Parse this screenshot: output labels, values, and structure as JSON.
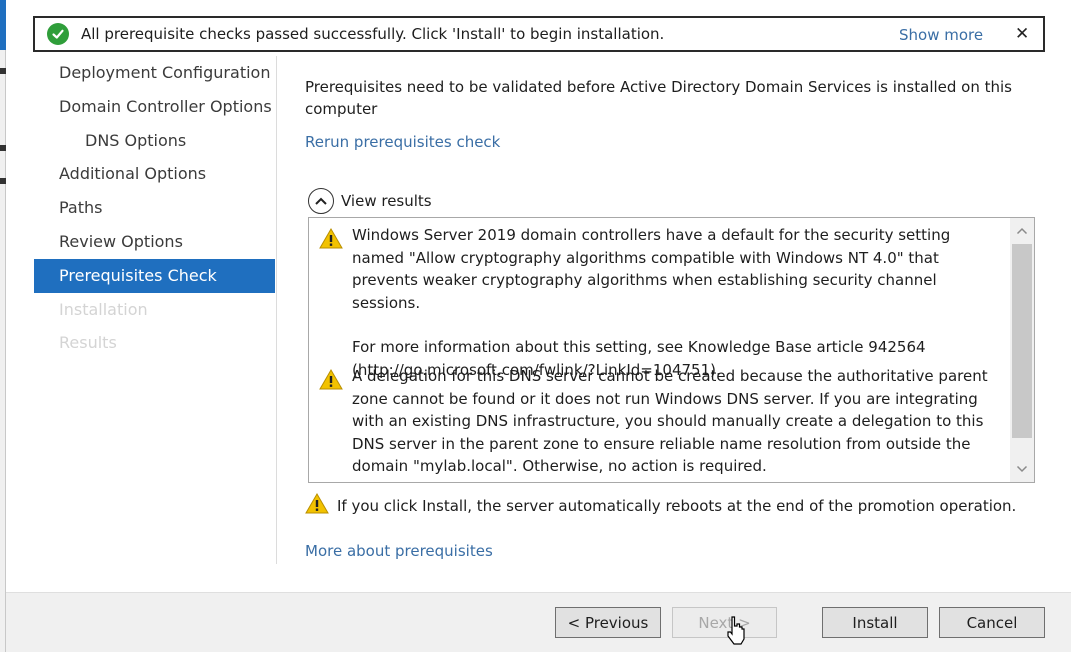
{
  "notification": {
    "message": "All prerequisite checks passed successfully.  Click 'Install' to begin installation.",
    "show_more_label": "Show more",
    "close_label": "✕",
    "status_color": "#2f9e3a"
  },
  "nav": {
    "items": [
      {
        "label": "Deployment Configuration",
        "state": "normal"
      },
      {
        "label": "Domain Controller Options",
        "state": "normal"
      },
      {
        "label": "DNS Options",
        "state": "sub"
      },
      {
        "label": "Additional Options",
        "state": "normal"
      },
      {
        "label": "Paths",
        "state": "normal"
      },
      {
        "label": "Review Options",
        "state": "normal"
      },
      {
        "label": "Prerequisites Check",
        "state": "active"
      },
      {
        "label": "Installation",
        "state": "disabled"
      },
      {
        "label": "Results",
        "state": "disabled"
      }
    ]
  },
  "main": {
    "intro": "Prerequisites need to be validated before Active Directory Domain Services is installed on this computer",
    "rerun_link": "Rerun prerequisites check",
    "view_results_label": "View results",
    "results": [
      {
        "icon": "warning-icon",
        "paragraphs": [
          "Windows Server 2019 domain controllers have a default for the security setting named \"Allow cryptography algorithms compatible with Windows NT 4.0\" that prevents weaker cryptography algorithms when establishing security channel sessions.",
          "For more information about this setting, see Knowledge Base article 942564 (http://go.microsoft.com/fwlink/?LinkId=104751)."
        ]
      },
      {
        "icon": "warning-icon",
        "paragraphs": [
          "A delegation for this DNS server cannot be created because the authoritative parent zone cannot be found or it does not run Windows DNS server. If you are integrating with an existing DNS infrastructure, you should manually create a delegation to this DNS server in the parent zone to ensure reliable name resolution from outside the domain \"mylab.local\". Otherwise, no action is required."
        ]
      }
    ],
    "reboot_warning": "If you click Install, the server automatically reboots at the end of the promotion operation.",
    "more_link": "More about prerequisites"
  },
  "footer": {
    "previous_label": "< Previous",
    "next_label": "Next >",
    "install_label": "Install",
    "cancel_label": "Cancel"
  },
  "colors": {
    "accent": "#1f6fbf",
    "link": "#3a6ea5",
    "warning": "#f2c200"
  }
}
